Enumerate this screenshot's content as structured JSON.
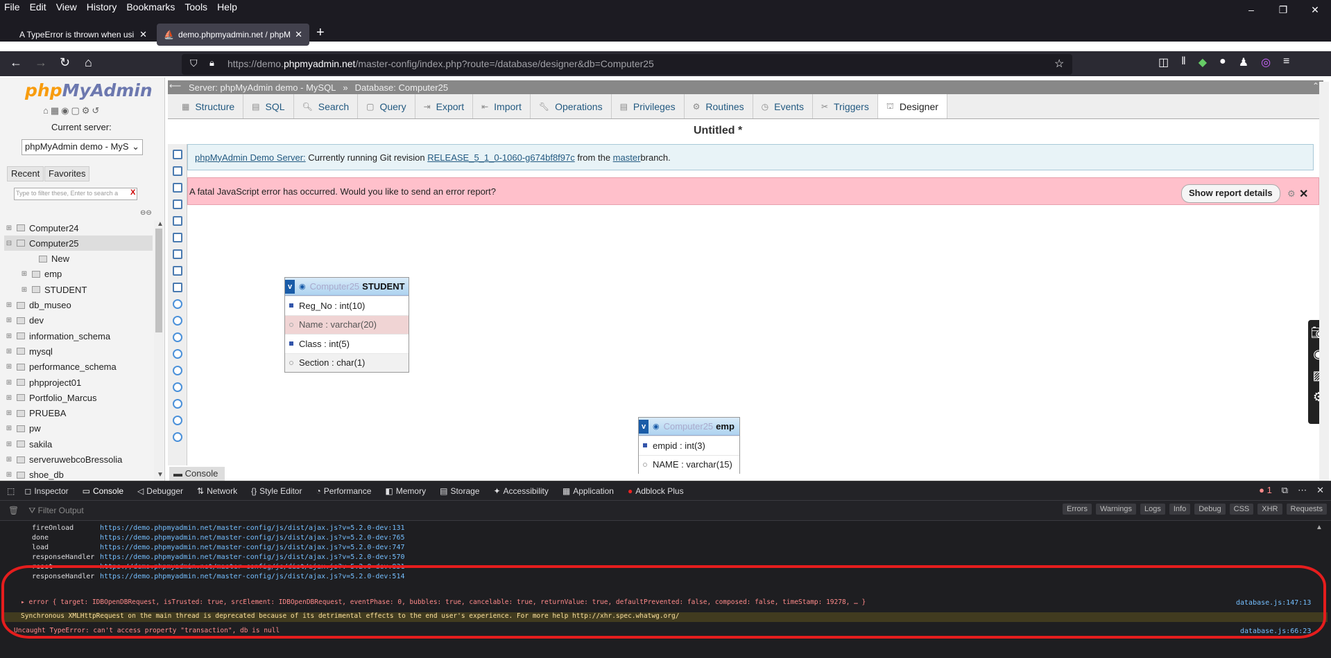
{
  "menu": [
    "File",
    "Edit",
    "View",
    "History",
    "Bookmarks",
    "Tools",
    "Help"
  ],
  "tabs": [
    {
      "title": "A TypeError is thrown when usin"
    },
    {
      "title": "demo.phpmyadmin.net / phpM"
    }
  ],
  "url": {
    "prefix": "https://demo.",
    "host": "phpmyadmin.net",
    "path": "/master-config/index.php?route=/database/designer&db=Computer25"
  },
  "nav": {
    "logo_a": "php",
    "logo_b": "MyAdmin",
    "current_server_label": "Current server:",
    "server_select": "phpMyAdmin demo - MyS",
    "recent": "Recent",
    "favorites": "Favorites",
    "filter_placeholder": "Type to filter these, Enter to search a",
    "tree": [
      "Computer24",
      "Computer25",
      "New",
      "emp",
      "STUDENT",
      "db_museo",
      "dev",
      "information_schema",
      "mysql",
      "performance_schema",
      "phpproject01",
      "Portfolio_Marcus",
      "PRUEBA",
      "pw",
      "sakila",
      "serveruwebcoBressolia",
      "shoe_db"
    ]
  },
  "breadcrumb": {
    "server": "Server: phpMyAdmin demo - MySQL",
    "sep": "»",
    "database": "Database: Computer25"
  },
  "main_tabs": [
    "Structure",
    "SQL",
    "Search",
    "Query",
    "Export",
    "Import",
    "Operations",
    "Privileges",
    "Routines",
    "Events",
    "Triggers",
    "Designer"
  ],
  "designer": {
    "title": "Untitled *",
    "notice_link": "phpMyAdmin Demo Server:",
    "notice_text": " Currently running Git revision ",
    "notice_rev": "RELEASE_5_1_0-1060-g674bf8f97c",
    "notice_mid": " from the ",
    "notice_branch": "master",
    "notice_end": " branch.",
    "error_text": "A fatal JavaScript error has occurred. Would you like to send an error report?",
    "report_button": "Show report details",
    "console_tab": "Console",
    "tables": [
      {
        "db": "Computer25",
        "name": "STUDENT",
        "columns": [
          "Reg_No : int(10)",
          "Name : varchar(20)",
          "Class : int(5)",
          "Section : char(1)"
        ]
      },
      {
        "db": "Computer25",
        "name": "emp",
        "columns": [
          "empid : int(3)",
          "NAME : varchar(15)"
        ]
      }
    ]
  },
  "devtools": {
    "tabs": [
      "Inspector",
      "Console",
      "Debugger",
      "Network",
      "Style Editor",
      "Performance",
      "Memory",
      "Storage",
      "Accessibility",
      "Application",
      "Adblock Plus"
    ],
    "error_count": "1",
    "filter_placeholder": "Filter Output",
    "filter_buttons": [
      "Errors",
      "Warnings",
      "Logs",
      "Info",
      "Debug",
      "CSS",
      "XHR",
      "Requests"
    ],
    "stack": [
      {
        "fn": "fireOnload",
        "src": "https://demo.phpmyadmin.net/master-config/js/dist/ajax.js?v=5.2.0-dev:131"
      },
      {
        "fn": "done",
        "src": "https://demo.phpmyadmin.net/master-config/js/dist/ajax.js?v=5.2.0-dev:765"
      },
      {
        "fn": "load",
        "src": "https://demo.phpmyadmin.net/master-config/js/dist/ajax.js?v=5.2.0-dev:747"
      },
      {
        "fn": "responseHandler",
        "src": "https://demo.phpmyadmin.net/master-config/js/dist/ajax.js?v=5.2.0-dev:570"
      },
      {
        "fn": "reset",
        "src": "https://demo.phpmyadmin.net/master-config/js/dist/ajax.js?v=5.2.0-dev:831"
      },
      {
        "fn": "responseHandler",
        "src": "https://demo.phpmyadmin.net/master-config/js/dist/ajax.js?v=5.2.0-dev:514"
      }
    ],
    "error_line": "error { target: IDBOpenDBRequest, isTrusted: true, srcElement: IDBOpenDBRequest, eventPhase: 0, bubbles: true, cancelable: true, returnValue: true, defaultPrevented: false, composed: false, timeStamp: 19278, … }",
    "error_src": "database.js:147:13",
    "warning_line": "Synchronous XMLHttpRequest on the main thread is deprecated because of its detrimental effects to the end user's experience. For more help http://xhr.spec.whatwg.org/",
    "last_line": "Uncaught TypeError: can't access property \"transaction\", db is null",
    "last_src": "database.js:66:23"
  },
  "colors": {
    "accent": "#235a81",
    "error_bg": "#ffc0cb",
    "annotation": "#e51d1d"
  }
}
